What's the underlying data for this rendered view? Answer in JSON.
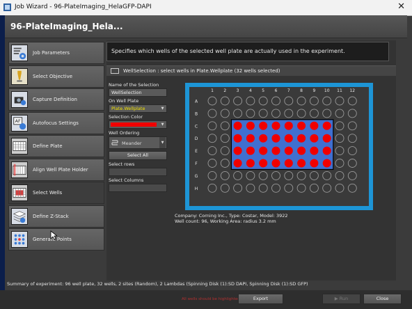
{
  "window": {
    "title": "Job Wizard - 96-PlateImaging_HelaGFP-DAPI",
    "close_glyph": "✕"
  },
  "header": {
    "title": "96-PlateImaging_Hela..."
  },
  "sidebar": {
    "items": [
      {
        "label": "Job Parameters",
        "icon": "job-parameters-icon"
      },
      {
        "label": "Select Objective",
        "icon": "objective-icon"
      },
      {
        "label": "Capture Definition",
        "icon": "camera-icon"
      },
      {
        "label": "Autofocus Settings",
        "icon": "autofocus-icon"
      },
      {
        "label": "Define Plate",
        "icon": "plate-grid-icon"
      },
      {
        "label": "Align Well Plate Holder",
        "icon": "align-plate-icon"
      },
      {
        "label": "Select Wells",
        "icon": "select-wells-icon",
        "active": true
      },
      {
        "label": "Define Z-Stack",
        "icon": "z-stack-icon"
      },
      {
        "label": "Generate Points",
        "icon": "generate-points-icon"
      }
    ]
  },
  "main": {
    "description": "Specifies which wells of the selected well plate are actually used in the experiment.",
    "section_title": "WellSelection : select wells in Plate.Wellplate (32 wells selected)"
  },
  "form": {
    "name_label": "Name of the Selection",
    "name_value": "WellSelection",
    "plate_label": "On Well Plate",
    "plate_value": "Plate.Wellplate",
    "color_label": "Selection Color",
    "color_value": "#f00000",
    "ordering_label": "Well Ordering",
    "ordering_value": "Meander",
    "select_all": "Select All",
    "rows_label": "Select rows",
    "columns_label": "Select Columns",
    "dropdown_glyph": "▼"
  },
  "plate": {
    "columns": [
      "1",
      "2",
      "3",
      "4",
      "5",
      "6",
      "7",
      "8",
      "9",
      "10",
      "11",
      "12"
    ],
    "rows": [
      "A",
      "B",
      "C",
      "D",
      "E",
      "F",
      "G",
      "H"
    ],
    "selected_rows": [
      "C",
      "D",
      "E",
      "F"
    ],
    "selected_columns": [
      "3",
      "4",
      "5",
      "6",
      "7",
      "8",
      "9",
      "10"
    ],
    "selected_count": 32,
    "colors": {
      "selected_well": "#f00000",
      "selection_bg": "#3f6fd0",
      "frame": "#1d95d6",
      "plate_bg": "#3a3a3a"
    },
    "info_line1": "Company: Corning Inc., Type: Costar, Model: 3922",
    "info_line2": "Well count: 96, Working Area: radius 3.2 mm"
  },
  "summary": "Summary of experiment: 96 well plate, 32 wells, 2 sites (Random), 2 Lambdas (Spinning Disk (1):SD DAPI, Spinning Disk (1):SD GFP)",
  "footer": {
    "hint": "All wells should be highlighted green.",
    "export": "Export",
    "run": "Run",
    "close": "Close"
  }
}
